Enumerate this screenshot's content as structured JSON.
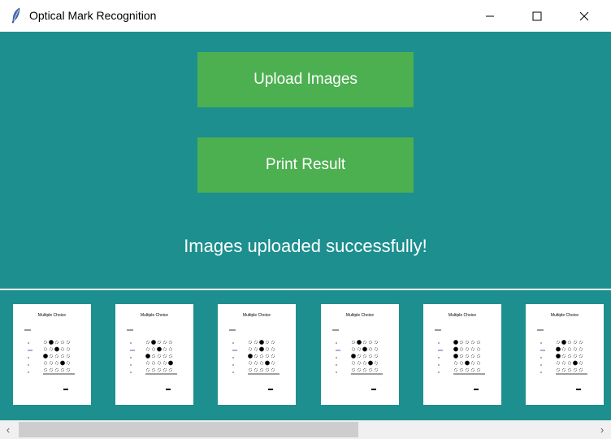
{
  "window": {
    "title": "Optical Mark Recognition",
    "icons": {
      "app": "feather-icon",
      "minimize": "minimize-icon",
      "maximize": "maximize-icon",
      "close": "close-icon"
    }
  },
  "main": {
    "upload_label": "Upload Images",
    "print_label": "Print Result",
    "status_text": "Images uploaded successfully!"
  },
  "thumbnails": {
    "count": 6,
    "items": [
      {
        "header": "Multiple Choice"
      },
      {
        "header": "Multiple Choice"
      },
      {
        "header": "Multiple Choice"
      },
      {
        "header": "Multiple Choice"
      },
      {
        "header": "Multiple Choice"
      },
      {
        "header": "Multiple Choice"
      }
    ]
  },
  "scrollbar": {
    "left_arrow": "‹",
    "right_arrow": "›",
    "position_fraction": 0.0
  },
  "colors": {
    "background": "#1d8f8f",
    "button": "#4caf50",
    "button_text": "#ffffff",
    "status_text": "#ffffff"
  }
}
